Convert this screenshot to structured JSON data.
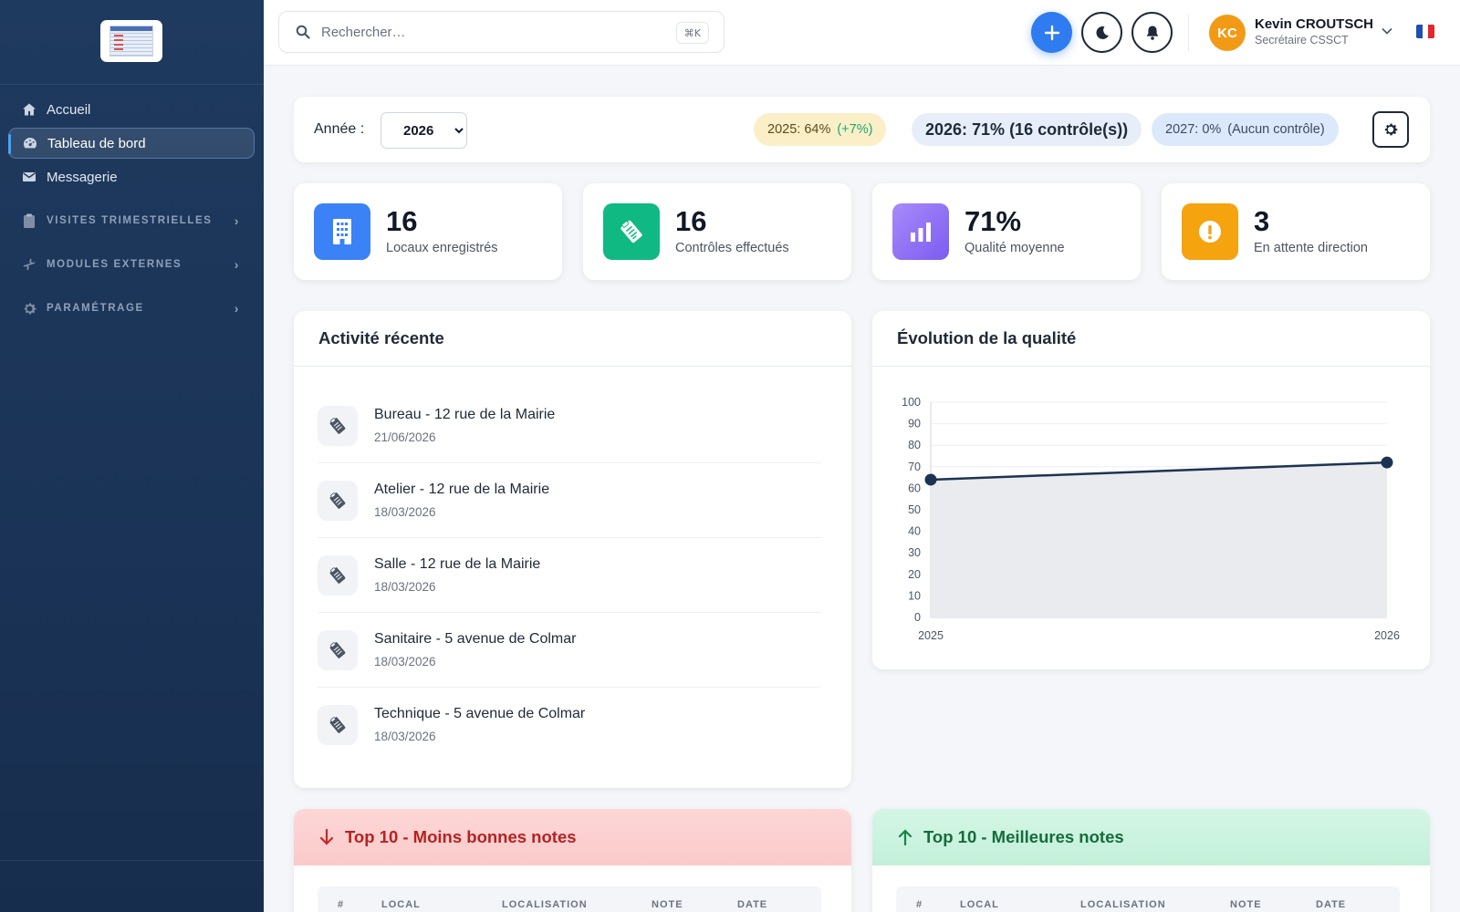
{
  "sidebar": {
    "items": [
      {
        "label": "Accueil",
        "icon": "home-icon"
      },
      {
        "label": "Tableau de bord",
        "icon": "dashboard-icon",
        "active": true
      },
      {
        "label": "Messagerie",
        "icon": "mail-icon"
      }
    ],
    "sections": [
      {
        "label": "VISITES TRIMESTRIELLES",
        "icon": "clipboard-icon"
      },
      {
        "label": "MODULES EXTERNES",
        "icon": "plug-icon"
      },
      {
        "label": "PARAMÉTRAGE",
        "icon": "gear-icon"
      }
    ]
  },
  "topbar": {
    "search_placeholder": "Rechercher…",
    "search_shortcut": "⌘K",
    "user": {
      "initials": "KC",
      "name": "Kevin CROUTSCH",
      "role": "Secrétaire CSSCT"
    },
    "language_flag": "fr"
  },
  "yearbar": {
    "label": "Année :",
    "selected_year": "2026",
    "year_options": [
      "2026"
    ],
    "pills": {
      "y2025": {
        "text": "2025:  64%",
        "delta": "(+7%)"
      },
      "y2026": {
        "text": "2026: 71% (16 contrôle(s))"
      },
      "y2027": {
        "text": "2027:  0%",
        "note": "(Aucun contrôle)"
      }
    }
  },
  "stats": [
    {
      "value": "16",
      "label": "Locaux enregistrés",
      "color": "#3b82f6",
      "icon": "building-icon"
    },
    {
      "value": "16",
      "label": "Contrôles effectués",
      "color": "#10b981",
      "icon": "clipboard-check-icon"
    },
    {
      "value": "71%",
      "label": "Qualité moyenne",
      "color": "#8b5cf6",
      "icon": "bar-chart-icon"
    },
    {
      "value": "3",
      "label": "En attente direction",
      "color": "#f59e0b",
      "icon": "alert-icon"
    }
  ],
  "activity": {
    "title": "Activité récente",
    "items": [
      {
        "title": "Bureau - 12 rue de la Mairie",
        "date": "21/06/2026"
      },
      {
        "title": "Atelier - 12 rue de la Mairie",
        "date": "18/03/2026"
      },
      {
        "title": "Salle - 12 rue de la Mairie",
        "date": "18/03/2026"
      },
      {
        "title": "Sanitaire - 5 avenue de Colmar",
        "date": "18/03/2026"
      },
      {
        "title": "Technique - 5 avenue de Colmar",
        "date": "18/03/2026"
      }
    ]
  },
  "quality": {
    "title": "Évolution de la qualité"
  },
  "chart_data": {
    "type": "area",
    "x": [
      "2025",
      "2026"
    ],
    "series": [
      {
        "values": [
          64,
          72
        ]
      }
    ],
    "ylim": [
      0,
      100
    ],
    "yticks": [
      0,
      10,
      20,
      30,
      40,
      50,
      60,
      70,
      80,
      90,
      100
    ],
    "grid": true,
    "line_color": "#1e3352",
    "fill_color": "#e9ebef"
  },
  "top_worst": {
    "title": "Top 10 - Moins bonnes notes",
    "columns": [
      "#",
      "LOCAL",
      "LOCALISATION",
      "NOTE",
      "DATE"
    ]
  },
  "top_best": {
    "title": "Top 10 - Meilleures notes",
    "columns": [
      "#",
      "LOCAL",
      "LOCALISATION",
      "NOTE",
      "DATE"
    ]
  }
}
